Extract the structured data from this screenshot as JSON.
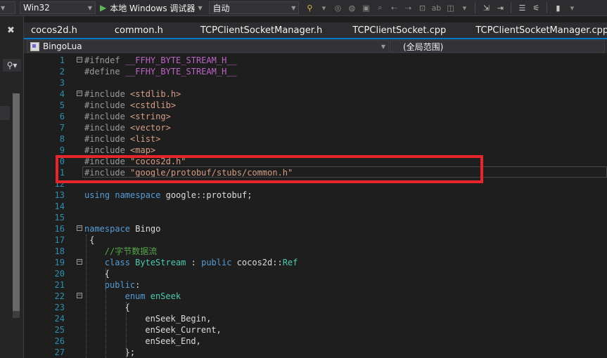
{
  "toolbar": {
    "platform": "Win32",
    "run_label": "本地 Windows 调试器",
    "config": "自动"
  },
  "tabs": [
    {
      "label": "cocos2d.h"
    },
    {
      "label": "common.h"
    },
    {
      "label": "TCPClientSocketManager.h"
    },
    {
      "label": "TCPClientSocket.cpp"
    },
    {
      "label": "TCPClientSocketManager.cpp"
    }
  ],
  "navbar": {
    "project": "BingoLua",
    "scope": "(全局范围)"
  },
  "code": {
    "lines": [
      {
        "num": "1",
        "tokens": [
          [
            "pp",
            "#ifndef "
          ],
          [
            "macro",
            "__FFHY_BYTE_STREAM_H__"
          ]
        ],
        "fold": "−",
        "indent": 0
      },
      {
        "num": "2",
        "tokens": [
          [
            "pp",
            "#define "
          ],
          [
            "macro",
            "__FFHY_BYTE_STREAM_H__"
          ]
        ],
        "indent": 0
      },
      {
        "num": "3",
        "tokens": [],
        "indent": 0
      },
      {
        "num": "4",
        "tokens": [
          [
            "pp",
            "#include "
          ],
          [
            "str",
            "<stdlib.h>"
          ]
        ],
        "fold": "−",
        "indent": 0
      },
      {
        "num": "5",
        "tokens": [
          [
            "pp",
            "#include "
          ],
          [
            "str",
            "<cstdlib>"
          ]
        ],
        "indent": 0
      },
      {
        "num": "6",
        "tokens": [
          [
            "pp",
            "#include "
          ],
          [
            "str",
            "<string>"
          ]
        ],
        "indent": 0
      },
      {
        "num": "7",
        "tokens": [
          [
            "pp",
            "#include "
          ],
          [
            "str",
            "<vector>"
          ]
        ],
        "indent": 0
      },
      {
        "num": "8",
        "tokens": [
          [
            "pp",
            "#include "
          ],
          [
            "str",
            "<list>"
          ]
        ],
        "indent": 0
      },
      {
        "num": "9",
        "tokens": [
          [
            "pp",
            "#include "
          ],
          [
            "str",
            "<map>"
          ]
        ],
        "indent": 0
      },
      {
        "num": "0",
        "tokens": [
          [
            "pp",
            "#include "
          ],
          [
            "str",
            "\"cocos2d.h\""
          ]
        ],
        "indent": 0
      },
      {
        "num": "1",
        "tokens": [
          [
            "pp",
            "#include "
          ],
          [
            "str",
            "\"google/protobuf/stubs/common.h\""
          ]
        ],
        "indent": 0
      },
      {
        "num": "12",
        "tokens": [],
        "indent": 0
      },
      {
        "num": "13",
        "tokens": [
          [
            "kw",
            "using "
          ],
          [
            "kw",
            "namespace "
          ],
          [
            "plain",
            "google::protobuf;"
          ]
        ],
        "indent": 0
      },
      {
        "num": "14",
        "tokens": [],
        "indent": 0
      },
      {
        "num": "15",
        "tokens": [],
        "indent": 0
      },
      {
        "num": "16",
        "tokens": [
          [
            "kw",
            "namespace "
          ],
          [
            "plain",
            "Bingo"
          ]
        ],
        "fold": "−",
        "indent": 0
      },
      {
        "num": "17",
        "tokens": [
          [
            "plain",
            "{"
          ]
        ],
        "indent": 1
      },
      {
        "num": "18",
        "tokens": [
          [
            "cm",
            "//字节数据流"
          ]
        ],
        "indent": 4
      },
      {
        "num": "19",
        "tokens": [
          [
            "kw",
            "class "
          ],
          [
            "type",
            "ByteStream "
          ],
          [
            "plain",
            ": "
          ],
          [
            "kw",
            "public "
          ],
          [
            "plain",
            "cocos2d::"
          ],
          [
            "type",
            "Ref"
          ]
        ],
        "fold": "−",
        "indent": 4
      },
      {
        "num": "20",
        "tokens": [
          [
            "plain",
            "{"
          ]
        ],
        "indent": 4
      },
      {
        "num": "21",
        "tokens": [
          [
            "kw",
            "public"
          ],
          [
            "plain",
            ":"
          ]
        ],
        "indent": 4
      },
      {
        "num": "22",
        "tokens": [
          [
            "kw",
            "enum "
          ],
          [
            "type",
            "enSeek"
          ]
        ],
        "fold": "−",
        "indent": 8
      },
      {
        "num": "23",
        "tokens": [
          [
            "plain",
            "{"
          ]
        ],
        "indent": 8
      },
      {
        "num": "24",
        "tokens": [
          [
            "plain",
            "enSeek_Begin,"
          ]
        ],
        "indent": 12
      },
      {
        "num": "25",
        "tokens": [
          [
            "plain",
            "enSeek_Current,"
          ]
        ],
        "indent": 12
      },
      {
        "num": "26",
        "tokens": [
          [
            "plain",
            "enSeek_End,"
          ]
        ],
        "indent": 12
      },
      {
        "num": "27",
        "tokens": [
          [
            "plain",
            "};"
          ]
        ],
        "indent": 8
      }
    ]
  }
}
